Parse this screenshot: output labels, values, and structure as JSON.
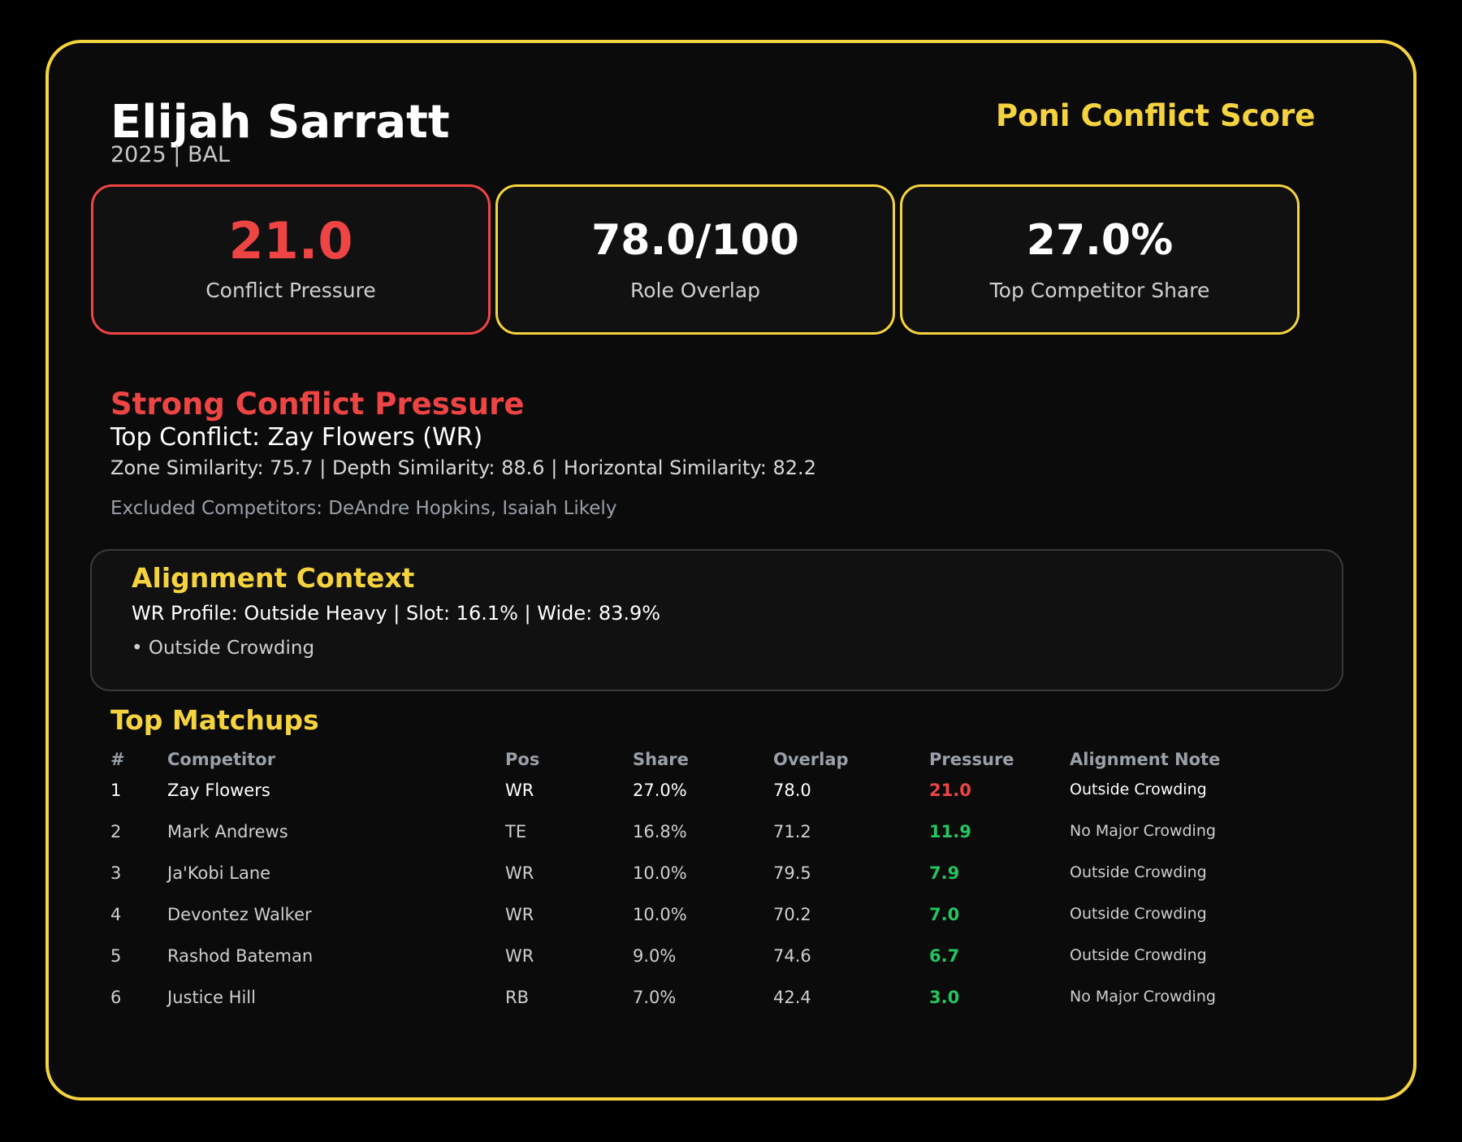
{
  "header": {
    "player_name": "Elijah Sarratt",
    "subtitle": "2025 | BAL",
    "brand_title": "Poni Conflict Score"
  },
  "stats": [
    {
      "value": "21.0",
      "label": "Conflict Pressure",
      "color": "#ef4444"
    },
    {
      "value": "78.0/100",
      "label": "Role Overlap",
      "color": "#ffffff"
    },
    {
      "value": "27.0%",
      "label": "Top Competitor Share",
      "color": "#ffffff"
    }
  ],
  "summary": {
    "verdict": "Strong Conflict Pressure",
    "top_conflict": "Top Conflict: Zay Flowers (WR)",
    "similarity": "Zone Similarity: 75.7 | Depth Similarity: 88.6 | Horizontal Similarity: 82.2",
    "excluded": "Excluded Competitors: DeAndre Hopkins, Isaiah Likely"
  },
  "alignment": {
    "title": "Alignment Context",
    "profile": "WR Profile: Outside Heavy | Slot: 16.1% | Wide: 83.9%",
    "bullet": "• Outside Crowding"
  },
  "matchups": {
    "title": "Top Matchups",
    "columns": [
      "#",
      "Competitor",
      "Pos",
      "Share",
      "Overlap",
      "Pressure",
      "Alignment Note"
    ],
    "rows": [
      {
        "rank": "1",
        "name": "Zay Flowers",
        "pos": "WR",
        "share": "27.0%",
        "overlap": "78.0",
        "pressure": "21.0",
        "note": "Outside Crowding",
        "pressure_color": "#ef4444"
      },
      {
        "rank": "2",
        "name": "Mark Andrews",
        "pos": "TE",
        "share": "16.8%",
        "overlap": "71.2",
        "pressure": "11.9",
        "note": "No Major Crowding",
        "pressure_color": "#22c55e"
      },
      {
        "rank": "3",
        "name": "Ja'Kobi Lane",
        "pos": "WR",
        "share": "10.0%",
        "overlap": "79.5",
        "pressure": "7.9",
        "note": "Outside Crowding",
        "pressure_color": "#22c55e"
      },
      {
        "rank": "4",
        "name": "Devontez Walker",
        "pos": "WR",
        "share": "10.0%",
        "overlap": "70.2",
        "pressure": "7.0",
        "note": "Outside Crowding",
        "pressure_color": "#22c55e"
      },
      {
        "rank": "5",
        "name": "Rashod Bateman",
        "pos": "WR",
        "share": "9.0%",
        "overlap": "74.6",
        "pressure": "6.7",
        "note": "Outside Crowding",
        "pressure_color": "#22c55e"
      },
      {
        "rank": "6",
        "name": "Justice Hill",
        "pos": "RB",
        "share": "7.0%",
        "overlap": "42.4",
        "pressure": "3.0",
        "note": "No Major Crowding",
        "pressure_color": "#22c55e"
      }
    ]
  },
  "colors": {
    "accent": "#f5d33f",
    "alert": "#ef4444",
    "positive": "#22c55e",
    "background": "#0b0b0b"
  }
}
